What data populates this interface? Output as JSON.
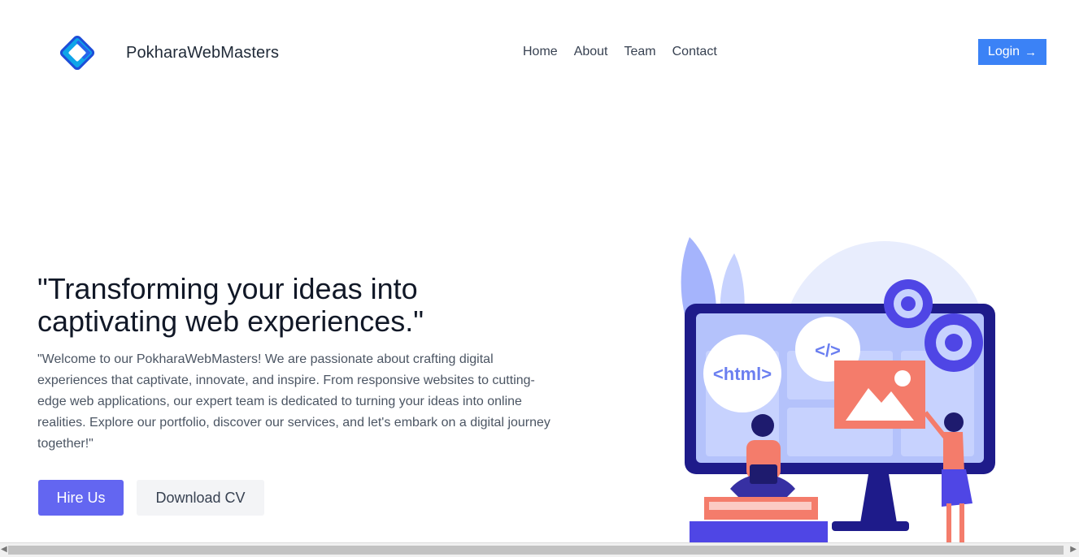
{
  "header": {
    "brand": "PokharaWebMasters",
    "nav": [
      "Home",
      "About",
      "Team",
      "Contact"
    ],
    "login_label": "Login",
    "login_icon": "→"
  },
  "hero": {
    "title": "\"Transforming your ideas into captivating web experiences.\"",
    "description": "\"Welcome to our PokharaWebMasters! We are passionate about crafting digital experiences that captivate, innovate, and inspire. From responsive websites to cutting-edge web applications, our expert team is dedicated to turning your ideas into online realities. Explore our portfolio, discover our services, and let's embark on a digital journey together!\"",
    "primary_button": "Hire Us",
    "secondary_button": "Download CV"
  },
  "illustration": {
    "html_tag": "<html>",
    "code_tag": "</>"
  },
  "colors": {
    "accent": "#6366f1",
    "login": "#3b82f6",
    "monitor": "#1e1b6e",
    "screen": "#a5b4fc"
  }
}
